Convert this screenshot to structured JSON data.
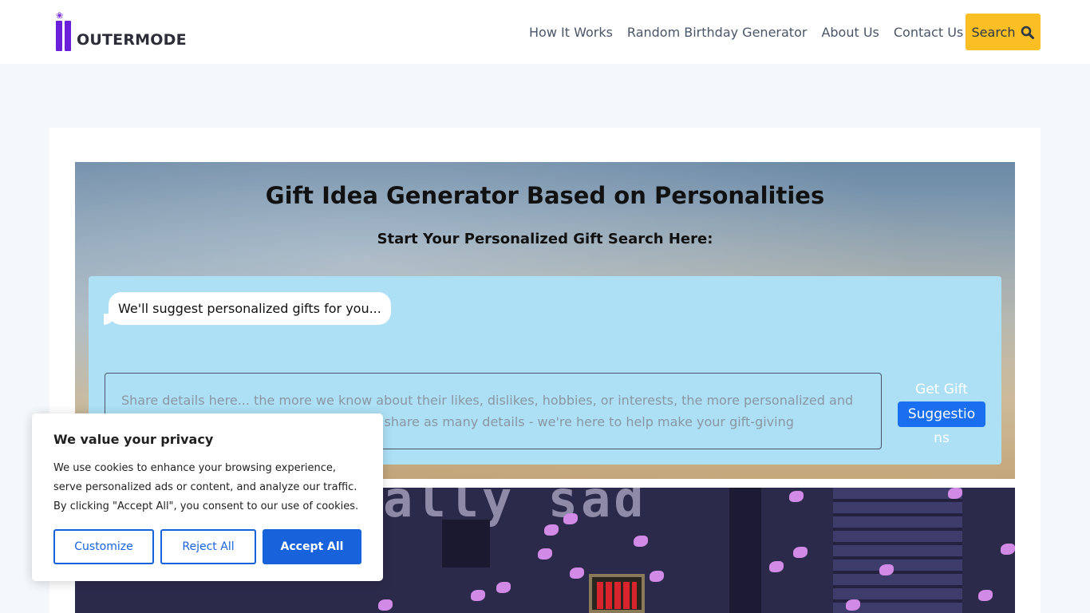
{
  "header": {
    "logo_text": "OUTERMODE",
    "nav": [
      "How It Works",
      "Random Birthday Generator",
      "About Us",
      "Contact Us"
    ],
    "search_label": "Search"
  },
  "hero": {
    "title": "Gift Idea Generator Based on Personalities",
    "subtitle": "Start Your Personalized Gift Search Here:",
    "bubble": "We'll suggest personalized gifts for you...",
    "details_placeholder": "Share details here... the more we know about their likes, dislikes, hobbies, or interests, the more personalized and perfect the gift ideas will be. Feel free to share as many details - we're here to help make your gift-giving experience unforgettable.",
    "button": {
      "line1": "Get Gift",
      "line2": "Suggestio",
      "line3": "ns"
    }
  },
  "banner": {
    "text": "ally sad"
  },
  "cookie": {
    "title": "We value your privacy",
    "text": "We use cookies to enhance your browsing experience, serve personalized ads or content, and analyze our traffic. By clicking \"Accept All\", you consent to our use of cookies.",
    "customize": "Customize",
    "reject": "Reject All",
    "accept": "Accept All"
  },
  "colors": {
    "brand_purple": "#6a1fd8",
    "search_yellow": "#fbbf24",
    "chat_bg": "#aee0f5",
    "button_blue": "#1a6ff0",
    "cookie_blue": "#1863dc"
  }
}
